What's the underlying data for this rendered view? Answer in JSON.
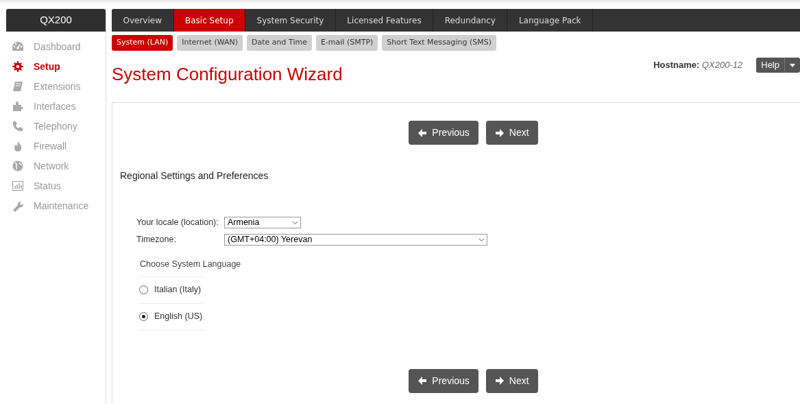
{
  "brand": "QX200",
  "sidebar": {
    "items": [
      {
        "label": "Dashboard",
        "selected": false
      },
      {
        "label": "Setup",
        "selected": true
      },
      {
        "label": "Extensions",
        "selected": false
      },
      {
        "label": "Interfaces",
        "selected": false
      },
      {
        "label": "Telephony",
        "selected": false
      },
      {
        "label": "Firewall",
        "selected": false
      },
      {
        "label": "Network",
        "selected": false
      },
      {
        "label": "Status",
        "selected": false
      },
      {
        "label": "Maintenance",
        "selected": false
      }
    ]
  },
  "tabs": [
    {
      "label": "Overview",
      "selected": false
    },
    {
      "label": "Basic Setup",
      "selected": true
    },
    {
      "label": "System Security",
      "selected": false
    },
    {
      "label": "Licensed Features",
      "selected": false
    },
    {
      "label": "Redundancy",
      "selected": false
    },
    {
      "label": "Language Pack",
      "selected": false
    }
  ],
  "subtabs": [
    {
      "label": "System (LAN)",
      "selected": true
    },
    {
      "label": "Internet (WAN)",
      "selected": false
    },
    {
      "label": "Date and Time",
      "selected": false
    },
    {
      "label": "E-mail (SMTP)",
      "selected": false
    },
    {
      "label": "Short Text Messaging (SMS)",
      "selected": false
    }
  ],
  "page_title": "System Configuration Wizard",
  "hostname": {
    "label": "Hostname:",
    "value": "QX200-12"
  },
  "help_button": "Help",
  "nav_buttons_top": [
    {
      "label": "Previous",
      "kind": "prev"
    },
    {
      "label": "Next",
      "kind": "next"
    }
  ],
  "section_title": "Regional Settings and Preferences",
  "fields": [
    {
      "label": "Your locale (location):",
      "value": "Armenia",
      "kind": "short"
    },
    {
      "label": "Timezone:",
      "value": "(GMT+04:00) Yerevan",
      "kind": "long"
    }
  ],
  "language": {
    "title": "Choose System Language",
    "options": [
      {
        "label": "Italian (Italy)",
        "selected": false
      },
      {
        "label": "English (US)",
        "selected": true
      }
    ]
  },
  "nav_buttons_bottom": [
    {
      "label": "Previous",
      "kind": "prev"
    },
    {
      "label": "Next",
      "kind": "next"
    }
  ]
}
